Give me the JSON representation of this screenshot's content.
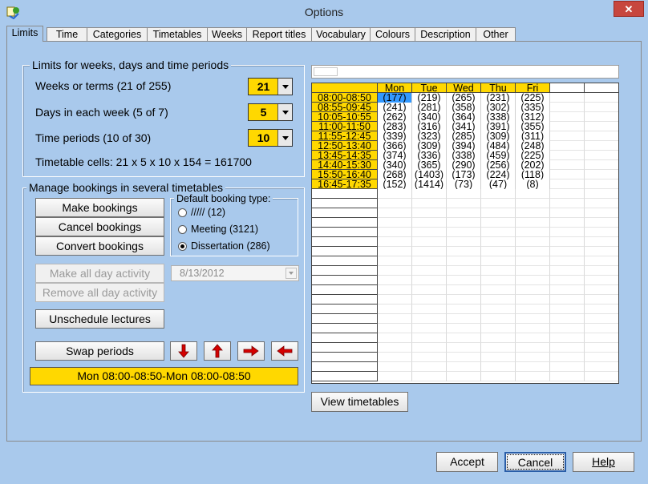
{
  "window": {
    "title": "Options",
    "close_label": "✕",
    "app_icon": "options-app-icon"
  },
  "tabs": [
    {
      "label": "Limits",
      "active": true
    },
    {
      "label": "Time"
    },
    {
      "label": "Categories"
    },
    {
      "label": "Timetables"
    },
    {
      "label": "Weeks"
    },
    {
      "label": "Report titles"
    },
    {
      "label": "Vocabulary"
    },
    {
      "label": "Colours"
    },
    {
      "label": "Description"
    },
    {
      "label": "Other"
    }
  ],
  "limits": {
    "title": "Limits for weeks, days and time periods",
    "weeks_label": "Weeks or terms (21 of 255)",
    "weeks_value": "21",
    "days_label": "Days in each week (5 of 7)",
    "days_value": "5",
    "periods_label": "Time periods (10 of 30)",
    "periods_value": "10",
    "cells_text": "Timetable cells: 21 x 5 x 10 x 154 = 161700"
  },
  "bookings": {
    "title": "Manage bookings in several timetables",
    "make": "Make bookings",
    "cancel": "Cancel bookings",
    "convert": "Convert bookings",
    "default_type_title": "Default booking type:",
    "types": [
      {
        "label": "///// (12)",
        "selected": false
      },
      {
        "label": "Meeting (3121)",
        "selected": false
      },
      {
        "label": "Dissertation (286)",
        "selected": true
      }
    ],
    "make_all_day": "Make all day activity",
    "remove_all_day": "Remove all day activity",
    "date_value": "8/13/2012",
    "unschedule": "Unschedule lectures",
    "swap": "Swap periods",
    "status": "Mon 08:00-08:50-Mon 08:00-08:50",
    "colors": {
      "accent_yellow": "#ffd800",
      "arrow_red": "#d40000"
    }
  },
  "grid": {
    "days": [
      "Mon",
      "Tue",
      "Wed",
      "Thu",
      "Fri"
    ],
    "rows": [
      {
        "time": "08:00-08:50",
        "values": [
          "(177)",
          "(219)",
          "(265)",
          "(231)",
          "(225)"
        ]
      },
      {
        "time": "08:55-09:45",
        "values": [
          "(241)",
          "(281)",
          "(358)",
          "(302)",
          "(335)"
        ]
      },
      {
        "time": "10:05-10:55",
        "values": [
          "(262)",
          "(340)",
          "(364)",
          "(338)",
          "(312)"
        ]
      },
      {
        "time": "11:00-11:50",
        "values": [
          "(283)",
          "(316)",
          "(341)",
          "(391)",
          "(355)"
        ]
      },
      {
        "time": "11:55-12:45",
        "values": [
          "(339)",
          "(323)",
          "(285)",
          "(309)",
          "(311)"
        ]
      },
      {
        "time": "12:50-13:40",
        "values": [
          "(366)",
          "(309)",
          "(394)",
          "(484)",
          "(248)"
        ]
      },
      {
        "time": "13:45-14:35",
        "values": [
          "(374)",
          "(336)",
          "(338)",
          "(459)",
          "(225)"
        ]
      },
      {
        "time": "14:40-15:30",
        "values": [
          "(340)",
          "(365)",
          "(290)",
          "(256)",
          "(202)"
        ]
      },
      {
        "time": "15:50-16:40",
        "values": [
          "(268)",
          "(1403)",
          "(173)",
          "(224)",
          "(118)"
        ]
      },
      {
        "time": "16:45-17:35",
        "values": [
          "(152)",
          "(1414)",
          "(73)",
          "(47)",
          "(8)"
        ]
      }
    ],
    "selected_cell": "(177)"
  },
  "view_timetables": "View timetables",
  "footer": {
    "accept": "Accept",
    "cancel": "Cancel",
    "help": "Help"
  }
}
